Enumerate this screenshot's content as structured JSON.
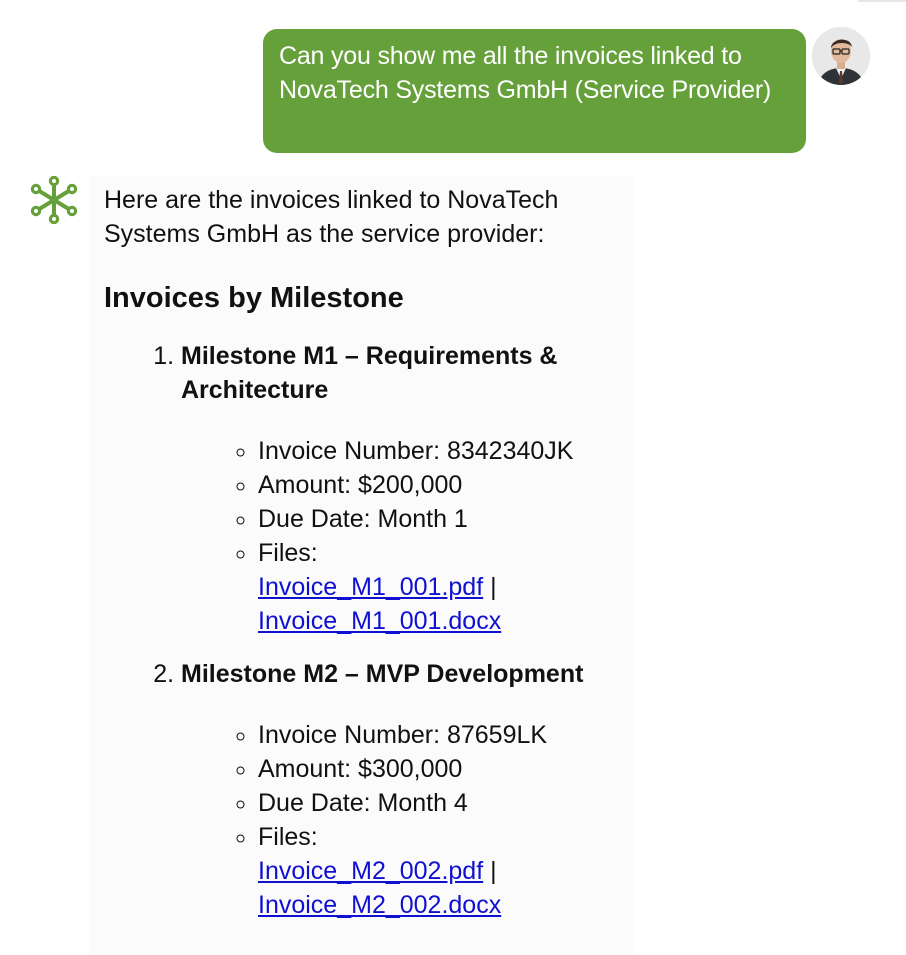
{
  "user_message": {
    "text": "Can you show me all the invoices linked to NovaTech Systems GmbH (Service Provider)"
  },
  "assistant": {
    "intro": "Here are the invoices linked to NovaTech Systems GmbH as the service provider:",
    "heading": "Invoices by Milestone",
    "milestones": [
      {
        "title": "Milestone M1 – Requirements & Architecture",
        "invoice_number": "Invoice Number: 8342340JK",
        "amount": "Amount: $200,000",
        "due_date": "Due Date: Month 1",
        "files_label": "Files:",
        "file_pdf": "Invoice_M1_001.pdf",
        "separator": "|",
        "file_docx": "Invoice_M1_001.docx"
      },
      {
        "title": "Milestone M2 – MVP Development",
        "invoice_number": "Invoice Number: 87659LK",
        "amount": "Amount: $300,000",
        "due_date": "Due Date: Month 4",
        "files_label": "Files:",
        "file_pdf": "Invoice_M2_002.pdf",
        "separator": "|",
        "file_docx": "Invoice_M2_002.docx"
      }
    ]
  },
  "icons": {
    "user_avatar": "user-avatar-photo",
    "assistant": "assistant-network-icon"
  },
  "colors": {
    "user_bubble": "#65a03a",
    "assistant_icon": "#65a03a",
    "link": "#1010d0"
  }
}
